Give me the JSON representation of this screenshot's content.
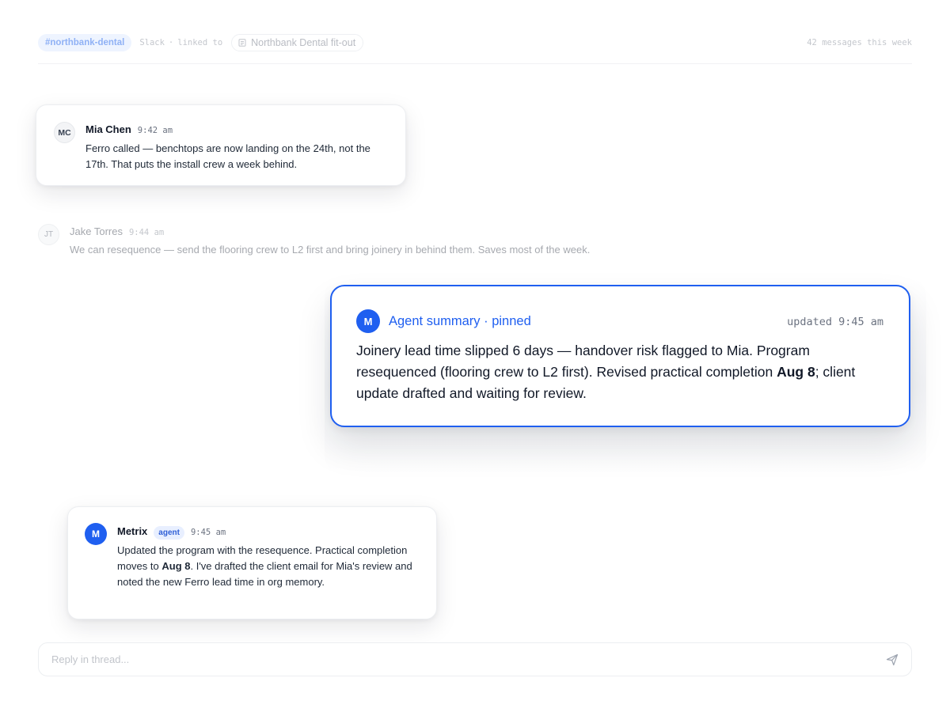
{
  "header": {
    "channel": "#northbank-dental",
    "source": "Slack",
    "linked_to": "linked to",
    "project": "Northbank Dental fit-out",
    "message_count": "42 messages this week"
  },
  "messages": [
    {
      "initials": "MC",
      "author": "Mia Chen",
      "time": "9:42 am",
      "text": "Ferro called — benchtops are now landing on the 24th, not the 17th. That puts the install crew a week behind."
    },
    {
      "initials": "JT",
      "author": "Jake Torres",
      "time": "9:44 am",
      "text": "We can resequence — send the flooring crew to L2 first and bring joinery in behind them. Saves most of the week."
    },
    {
      "initials": "M",
      "author": "Metrix",
      "tag": "agent",
      "time": "9:45 am",
      "text_before": "Updated the program with the resequence. Practical completion moves to ",
      "text_bold": "Aug 8",
      "text_after": ". I've drafted the client email for Mia's review and noted the new Ferro lead time in org memory."
    }
  ],
  "summary": {
    "initial": "M",
    "title": "Agent summary · pinned",
    "updated": "updated 9:45 am",
    "text_before": "Joinery lead time slipped 6 days — handover risk flagged to Mia. Program resequenced (flooring crew to L2 first). Revised practical completion ",
    "text_bold": "Aug 8",
    "text_after": "; client update drafted and waiting for review."
  },
  "reply": {
    "placeholder": "Reply in thread..."
  },
  "colors": {
    "accent": "#1f5ff0",
    "agent_tag_bg": "#e8efff",
    "channel_pill_bg": "#eef4ff"
  },
  "icons": {
    "linked_doc": "document-icon",
    "send": "send-icon"
  }
}
